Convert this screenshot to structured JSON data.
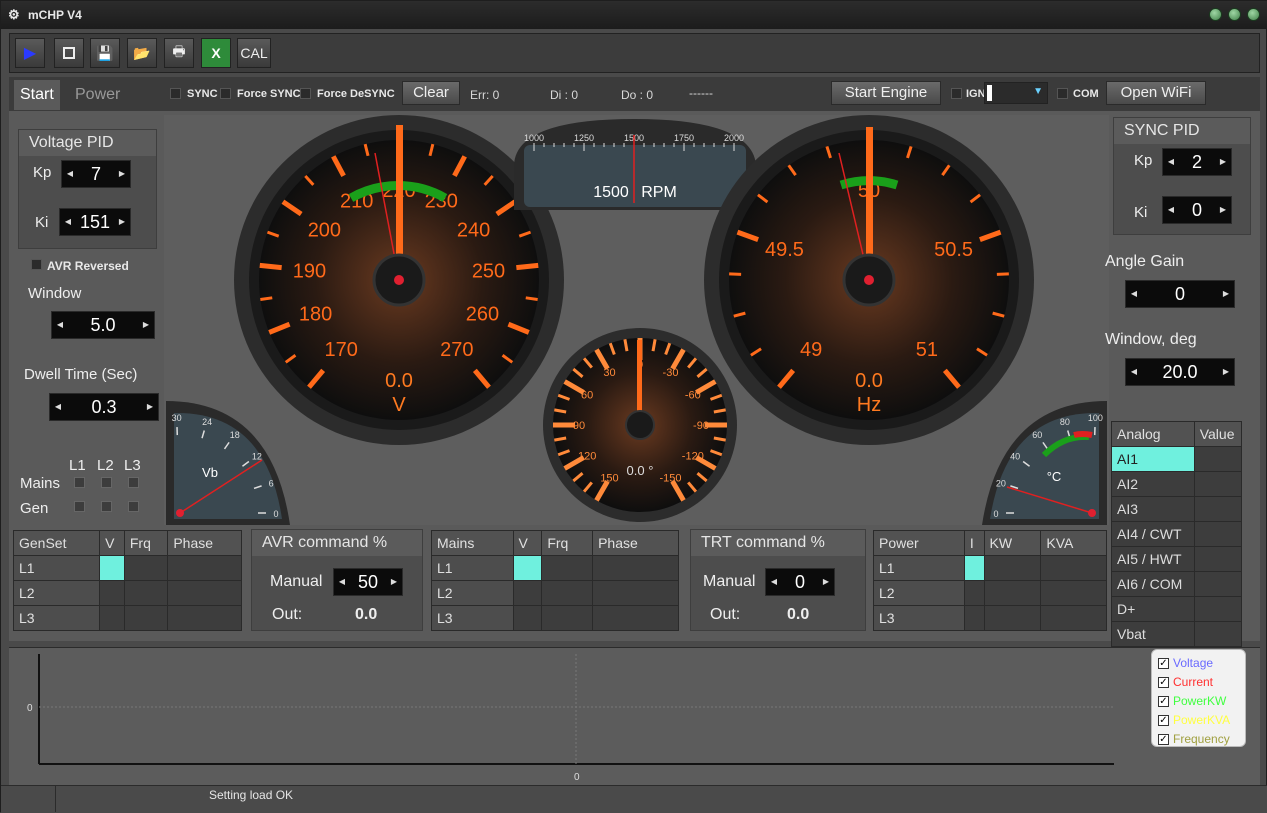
{
  "window": {
    "title": "mCHP V4"
  },
  "toolbar": {
    "cal_label": "CAL"
  },
  "tabs": [
    {
      "label": "Start"
    },
    {
      "label": "Power"
    }
  ],
  "sync": {
    "sync_label": "SYNC",
    "force_sync_label": "Force SYNC",
    "force_desync_label": "Force DeSYNC",
    "clear_label": "Clear",
    "err": "Err:  0",
    "di": "Di :  0",
    "do": "Do : 0",
    "dash": "------"
  },
  "engine": {
    "start_label": "Start Engine",
    "ign_label": "IGN",
    "com_label": "COM",
    "wifi_label": "Open WiFi"
  },
  "voltage_pid": {
    "title": "Voltage PID",
    "kp_label": "Kp",
    "kp": "7",
    "ki_label": "Ki",
    "ki": "151"
  },
  "avr_reversed_label": "AVR Reversed",
  "window_ctrl": {
    "label": "Window",
    "value": "5.0"
  },
  "dwell": {
    "label": "Dwell Time (Sec)",
    "value": "0.3"
  },
  "mains_gen": {
    "l1": "L1",
    "l2": "L2",
    "l3": "L3",
    "mains": "Mains",
    "gen": "Gen"
  },
  "sync_pid": {
    "title": "SYNC PID",
    "kp_label": "Kp",
    "kp": "2",
    "ki_label": "Ki",
    "ki": "0"
  },
  "angle_gain": {
    "label": "Angle Gain",
    "value": "0"
  },
  "window_deg": {
    "label": "Window, deg",
    "value": "20.0"
  },
  "volt_gauge": {
    "ticks": [
      "170",
      "180",
      "190",
      "200",
      "210",
      "220",
      "230",
      "240",
      "250",
      "260",
      "270"
    ],
    "value": "0.0",
    "unit": "V",
    "needle": 220
  },
  "hz_gauge": {
    "ticks": [
      "49",
      "49.5",
      "50",
      "50.5",
      "51"
    ],
    "value": "0.0",
    "unit": "Hz",
    "needle": 50
  },
  "rpm_gauge": {
    "ticks": [
      "1000",
      "1250",
      "1500",
      "1750",
      "2000"
    ],
    "value": "1500",
    "unit": "RPM"
  },
  "phase_gauge": {
    "ticks": [
      "150",
      "120",
      "90",
      "60",
      "30",
      "0",
      "-30",
      "-60",
      "-90",
      "-120",
      "-150"
    ],
    "value": "0.0 °"
  },
  "vb_gauge": {
    "ticks": [
      "30",
      "24",
      "18",
      "12",
      "6",
      "0"
    ],
    "label": "Vb"
  },
  "temp_gauge": {
    "ticks": [
      "0",
      "20",
      "40",
      "60",
      "80",
      "100"
    ],
    "label": "°C"
  },
  "analog": {
    "headers": [
      "Analog",
      "Value"
    ],
    "rows": [
      "AI1",
      "AI2",
      "AI3",
      "AI4 / CWT",
      "AI5 / HWT",
      "AI6 / COM",
      "D+",
      "Vbat"
    ]
  },
  "genset_table": {
    "headers": [
      "GenSet",
      "V",
      "Frq",
      "Phase"
    ],
    "rows": [
      "L1",
      "L2",
      "L3"
    ]
  },
  "avr_cmd": {
    "title": "AVR command %",
    "manual_label": "Manual",
    "manual": "50",
    "out_label": "Out:",
    "out": "0.0"
  },
  "mains_table": {
    "headers": [
      "Mains",
      "V",
      "Frq",
      "Phase"
    ],
    "rows": [
      "L1",
      "L2",
      "L3"
    ]
  },
  "trt_cmd": {
    "title": "TRT command %",
    "manual_label": "Manual",
    "manual": "0",
    "out_label": "Out:",
    "out": "0.0"
  },
  "power_table": {
    "headers": [
      "Power",
      "I",
      "KW",
      "KVA"
    ],
    "rows": [
      "L1",
      "L2",
      "L3"
    ]
  },
  "chart_data": {
    "type": "line",
    "series": [
      {
        "name": "Voltage",
        "values": []
      },
      {
        "name": "Current",
        "values": []
      },
      {
        "name": "PowerKW",
        "values": []
      },
      {
        "name": "PowerKVA",
        "values": []
      },
      {
        "name": "Frequency",
        "values": []
      }
    ],
    "y_tick": "0",
    "x_tick": "0",
    "colors": {
      "Voltage": "#6a6aff",
      "Current": "#ff3030",
      "PowerKW": "#40ff40",
      "PowerKVA": "#ffff40",
      "Frequency": "#a0a040"
    }
  },
  "status": {
    "message": "Setting load OK"
  },
  "colors": {
    "accent_orange": "#ff5a1e",
    "cyan": "#6ff0de"
  }
}
